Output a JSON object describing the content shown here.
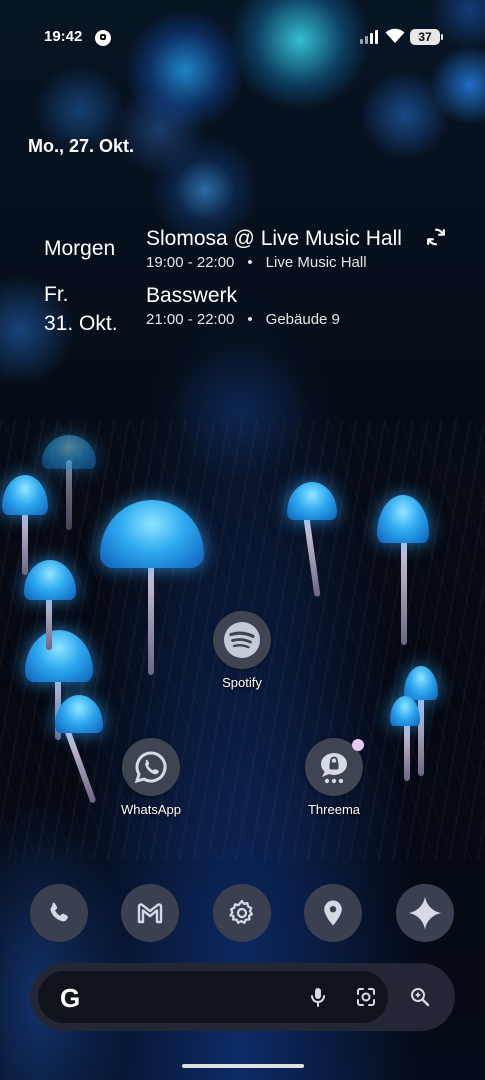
{
  "status_bar": {
    "time": "19:42",
    "battery": "37"
  },
  "date": "Mo., 27. Okt.",
  "agenda": [
    {
      "day": "Morgen",
      "title": "Slomosa @ Live Music Hall",
      "time": "19:00 - 22:00",
      "separator": "•",
      "location": "Live Music Hall"
    },
    {
      "day_line1": "Fr.",
      "day_line2": "31. Okt.",
      "title": "Basswerk",
      "time": "21:00 - 22:00",
      "separator": "•",
      "location": "Gebäude 9"
    }
  ],
  "apps": {
    "spotify": "Spotify",
    "whatsapp": "WhatsApp",
    "threema": "Threema"
  },
  "search": {
    "logo": "G",
    "placeholder": ""
  }
}
